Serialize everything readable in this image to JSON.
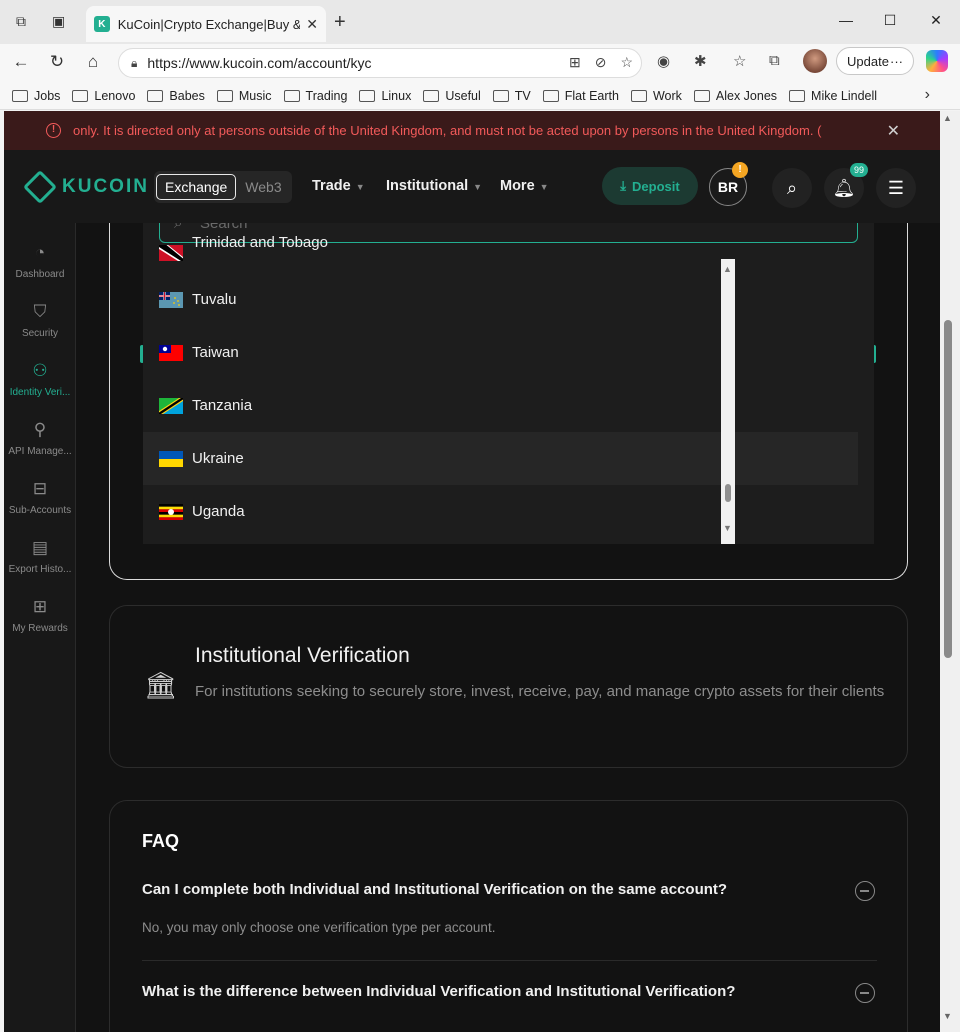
{
  "browser": {
    "tab_title": "KuCoin|Crypto Exchange|Buy & Se",
    "url": "https://www.kucoin.com/account/kyc",
    "update_label": "Update",
    "bookmarks": [
      "Jobs",
      "Lenovo",
      "Babes",
      "Music",
      "Trading",
      "Linux",
      "Useful",
      "TV",
      "Flat Earth",
      "Work",
      "Alex Jones",
      "Mike Lindell"
    ]
  },
  "banner": {
    "text": "only. It is directed only at persons outside of the United Kingdom, and must not be acted upon by persons in the United Kingdom. ("
  },
  "header": {
    "logo": "KUCOIN",
    "switch_selected": "Exchange",
    "switch_other": "Web3",
    "nav": [
      "Trade",
      "Institutional",
      "More"
    ],
    "deposit": "Deposit",
    "avatar_initials": "BR",
    "avatar_badge": "!",
    "notif_badge": "99"
  },
  "sidebar": {
    "items": [
      {
        "label": "Dashboard",
        "icon": "pie-chart-icon"
      },
      {
        "label": "Security",
        "icon": "shield-icon"
      },
      {
        "label": "Identity Veri...",
        "icon": "identity-icon"
      },
      {
        "label": "API Manage...",
        "icon": "api-icon"
      },
      {
        "label": "Sub-Accounts",
        "icon": "sub-accounts-icon"
      },
      {
        "label": "Export Histo...",
        "icon": "clipboard-icon"
      },
      {
        "label": "My Rewards",
        "icon": "gift-icon"
      }
    ]
  },
  "country_dropdown": {
    "search_placeholder": "Search",
    "countries": [
      {
        "name": "Trinidad and Tobago"
      },
      {
        "name": "Tuvalu"
      },
      {
        "name": "Taiwan"
      },
      {
        "name": "Tanzania"
      },
      {
        "name": "Ukraine"
      },
      {
        "name": "Uganda"
      }
    ]
  },
  "institutional": {
    "title": "Institutional Verification",
    "desc": "For institutions seeking to securely store, invest, receive, pay, and manage crypto assets for their clients"
  },
  "faq": {
    "title": "FAQ",
    "items": [
      {
        "q": "Can I complete both Individual and Institutional Verification on the same account?",
        "a": "No, you may only choose one verification type per account."
      },
      {
        "q": "What is the difference between Individual Verification and Institutional Verification?",
        "a": ""
      }
    ]
  },
  "colors": {
    "accent": "#23af91",
    "warning": "#f25a5a",
    "background": "#121212"
  }
}
